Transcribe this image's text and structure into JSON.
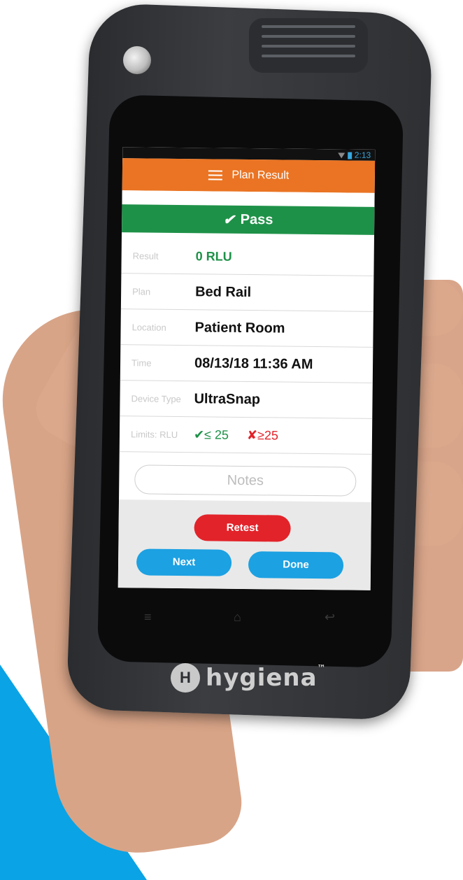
{
  "status": {
    "time": "2:13"
  },
  "appbar": {
    "title": "Plan Result"
  },
  "result_banner": {
    "check": "✔",
    "label": "Pass"
  },
  "details": [
    {
      "label": "Result",
      "value": "0 RLU"
    },
    {
      "label": "Plan",
      "value": "Bed Rail"
    },
    {
      "label": "Location",
      "value": "Patient Room"
    },
    {
      "label": "Time",
      "value": "08/13/18 11:36 AM"
    },
    {
      "label": "Device Type",
      "value": "UltraSnap"
    }
  ],
  "limits": {
    "label": "Limits: RLU",
    "pass": "✔≤ 25",
    "fail": "✘≥25"
  },
  "notes": {
    "placeholder": "Notes"
  },
  "buttons": {
    "retest": "Retest",
    "next": "Next",
    "done": "Done"
  },
  "brand": {
    "name": "hygiena",
    "trademark": "™"
  },
  "colors": {
    "appbar": "#ea7423",
    "pass": "#1e9148",
    "retest": "#e2232a",
    "primary": "#1ca1e2"
  },
  "icons": {
    "menu": "menu-icon",
    "wifi": "wifi-icon",
    "battery": "battery-icon",
    "softkey_menu": "menu-softkey-icon",
    "softkey_home": "home-icon",
    "softkey_back": "back-icon"
  }
}
